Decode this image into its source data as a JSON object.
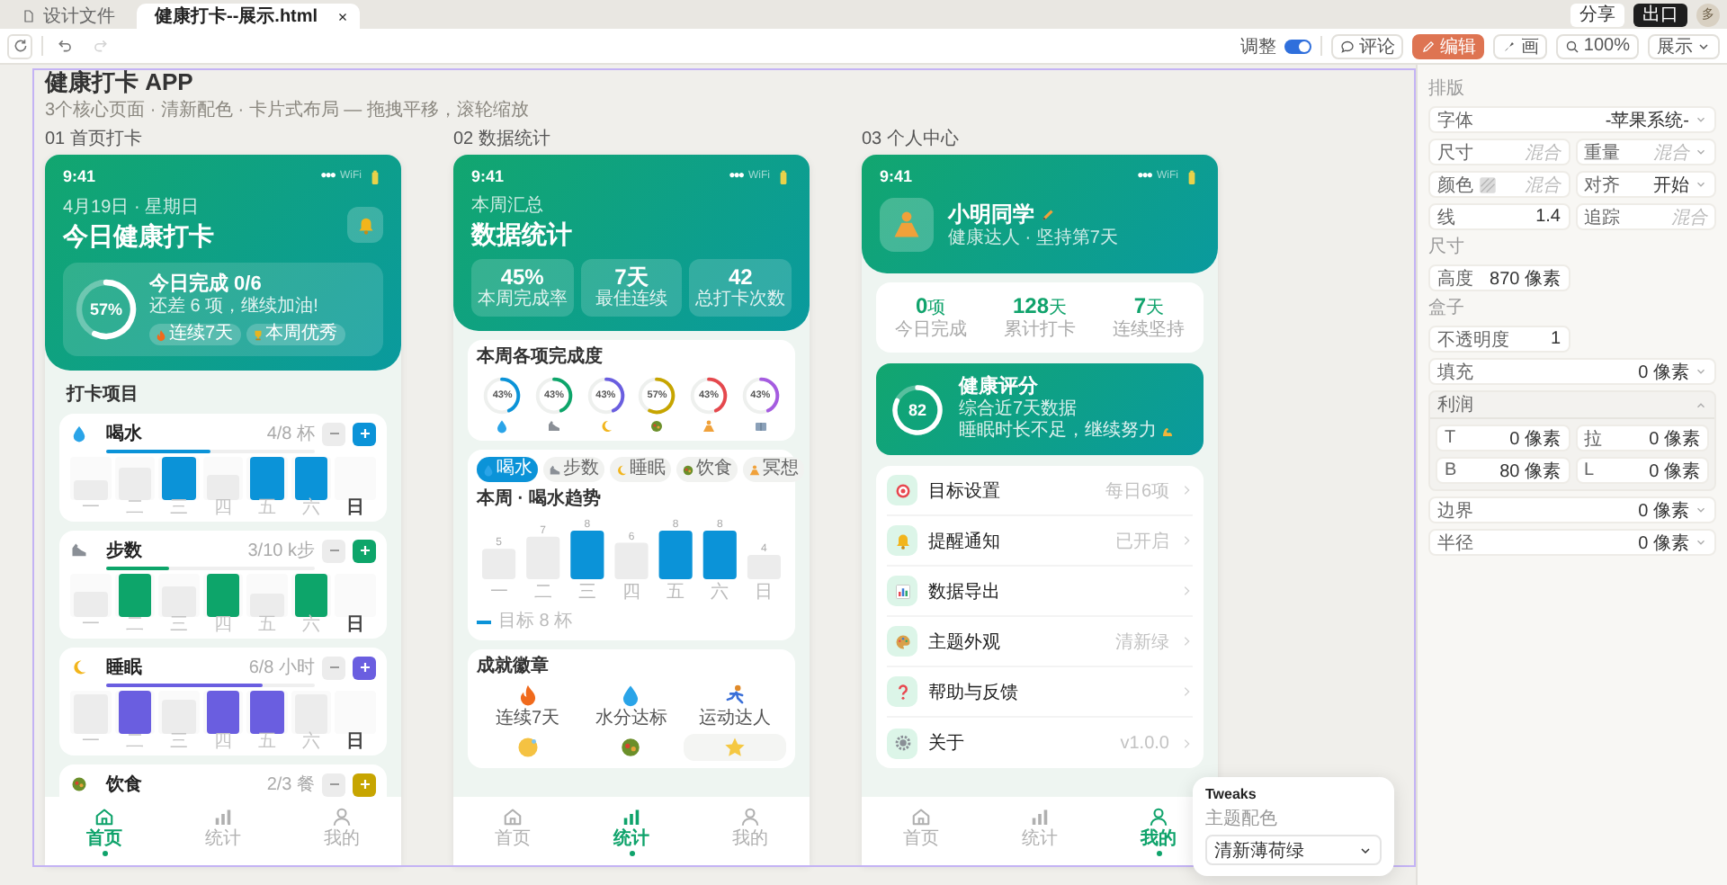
{
  "topbar": {
    "tabs": [
      {
        "label": "设计文件",
        "selected": false
      },
      {
        "label": "健康打卡--展示.html",
        "selected": true
      }
    ],
    "share": "分享",
    "export": "出口",
    "avatar": "多"
  },
  "toolbar": {
    "tweak_label": "调整",
    "tweak_on": true,
    "redo_disabled": true,
    "modes": [
      {
        "label": "评论",
        "selected": false
      },
      {
        "label": "编辑",
        "selected": true
      },
      {
        "label": "画",
        "selected": false
      }
    ],
    "zoom": "100%",
    "present": "展示"
  },
  "canvas": {
    "title": "健康打卡 APP",
    "subtitle": "3个核心页面 · 清新配色 · 卡片式布局 — 拖拽平移，滚轮缩放"
  },
  "screens": [
    {
      "label": "01 首页打卡",
      "kind": "home",
      "status": {
        "time": "9:41",
        "signal": "●●●",
        "network": "WiFi"
      },
      "header": {
        "date": "4月19日 · 星期日",
        "title": "今日健康打卡"
      },
      "summary": {
        "ring_label": "57%",
        "level": 0.57,
        "title": "今日完成 0/6",
        "note": "还差 6 项，继续加油!",
        "chips": [
          "连续7天",
          "本周优秀"
        ]
      },
      "section": "打卡项目",
      "habits": [
        {
          "name": "喝水",
          "amount": "4/8 杯",
          "color": "#0b93d8",
          "level": 0.5,
          "days": [
            {
              "label": "一",
              "level": 0.45,
              "done": false,
              "today": false
            },
            {
              "label": "二",
              "level": 0.75,
              "done": false,
              "today": false
            },
            {
              "label": "三",
              "level": 1,
              "done": true,
              "today": false
            },
            {
              "label": "四",
              "level": 0.6,
              "done": false,
              "today": false
            },
            {
              "label": "五",
              "level": 1,
              "done": true,
              "today": false
            },
            {
              "label": "六",
              "level": 1,
              "done": true,
              "today": false
            },
            {
              "label": "日",
              "today": true
            }
          ]
        },
        {
          "name": "步数",
          "amount": "3/10 k步",
          "color": "#0da56a",
          "level": 0.3,
          "days": [
            {
              "label": "一",
              "level": 0.6,
              "done": false,
              "today": false
            },
            {
              "label": "二",
              "level": 1,
              "done": true,
              "today": false
            },
            {
              "label": "三",
              "level": 0.7,
              "done": false,
              "today": false
            },
            {
              "label": "四",
              "level": 1,
              "done": true,
              "today": false
            },
            {
              "label": "五",
              "level": 0.55,
              "done": false,
              "today": false
            },
            {
              "label": "六",
              "level": 1,
              "done": true,
              "today": false
            },
            {
              "label": "日",
              "today": true
            }
          ]
        },
        {
          "name": "睡眠",
          "amount": "6/8 小时",
          "color": "#6a5ee0",
          "level": 0.75,
          "days": [
            {
              "label": "一",
              "level": 0.9,
              "done": false,
              "today": false
            },
            {
              "label": "二",
              "level": 1,
              "done": true,
              "today": false
            },
            {
              "label": "三",
              "level": 0.8,
              "done": false,
              "today": false
            },
            {
              "label": "四",
              "level": 1,
              "done": true,
              "today": false
            },
            {
              "label": "五",
              "level": 1,
              "done": true,
              "today": false
            },
            {
              "label": "六",
              "level": 0.9,
              "done": false,
              "today": false
            },
            {
              "label": "日",
              "today": true
            }
          ]
        },
        {
          "name": "饮食",
          "amount": "2/3 餐",
          "color": "#c7a500"
        }
      ],
      "nav": [
        {
          "label": "首页",
          "selected": true
        },
        {
          "label": "统计",
          "selected": false
        },
        {
          "label": "我的",
          "selected": false
        }
      ]
    },
    {
      "label": "02 数据统计",
      "kind": "stats",
      "status": {
        "time": "9:41",
        "signal": "●●●",
        "network": "WiFi"
      },
      "header": {
        "date": "本周汇总",
        "title": "数据统计"
      },
      "tiles": [
        {
          "value": "45%",
          "label": "本周完成率"
        },
        {
          "value": "7天",
          "label": "最佳连续"
        },
        {
          "value": "42",
          "label": "总打卡次数"
        }
      ],
      "rings": {
        "title": "本周各项完成度",
        "items": [
          {
            "label": "43%",
            "level": 0.43,
            "color": "#0b93d8"
          },
          {
            "label": "43%",
            "level": 0.43,
            "color": "#0da56a"
          },
          {
            "label": "43%",
            "level": 0.43,
            "color": "#6a5ee0"
          },
          {
            "label": "57%",
            "level": 0.57,
            "color": "#c7a500"
          },
          {
            "label": "43%",
            "level": 0.43,
            "color": "#e5484d"
          },
          {
            "label": "43%",
            "level": 0.43,
            "color": "#a55ce0"
          }
        ]
      },
      "trend": {
        "chips": [
          {
            "label": "喝水",
            "selected": true
          },
          {
            "label": "步数",
            "selected": false
          },
          {
            "label": "睡眠",
            "selected": false
          },
          {
            "label": "饮食",
            "selected": false
          },
          {
            "label": "冥想",
            "selected": false
          }
        ],
        "title": "本周 · 喝水趋势",
        "chart_data": {
          "type": "bar",
          "categories": [
            "一",
            "二",
            "三",
            "四",
            "五",
            "六",
            "日"
          ],
          "series": [
            {
              "color": "#0b93d8",
              "values": [
                null,
                null,
                8,
                null,
                8,
                8,
                null
              ]
            },
            {
              "color": "#ececec",
              "values": [
                5,
                7,
                null,
                6,
                null,
                null,
                4
              ]
            }
          ],
          "data_labels": true
        },
        "legend": "目标 8 杯"
      },
      "badges": {
        "title": "成就徽章",
        "items": [
          {
            "label": "连续7天",
            "highlighted": false
          },
          {
            "label": "水分达标",
            "highlighted": false
          },
          {
            "label": "运动达人",
            "highlighted": false
          },
          {
            "highlighted": false
          },
          {
            "highlighted": false
          },
          {
            "highlighted": true
          }
        ]
      },
      "nav": [
        {
          "label": "首页",
          "selected": false
        },
        {
          "label": "统计",
          "selected": true
        },
        {
          "label": "我的",
          "selected": false
        }
      ]
    },
    {
      "label": "03 个人中心",
      "kind": "profile",
      "status": {
        "time": "9:41",
        "signal": "●●●",
        "network": "WiFi"
      },
      "user": {
        "name": "小明同学",
        "note": "健康达人 · 坚持第7天"
      },
      "stats": [
        {
          "value": "0",
          "unit": "项",
          "label": "今日完成"
        },
        {
          "value": "128",
          "unit": "天",
          "label": "累计打卡"
        },
        {
          "value": "7",
          "unit": "天",
          "label": "连续坚持"
        }
      ],
      "score": {
        "value": "82",
        "level": 0.82,
        "title": "健康评分",
        "note": "综合近7天数据",
        "advice": "睡眠时长不足，继续努力"
      },
      "menu": [
        {
          "label": "目标设置",
          "value": "每日6项"
        },
        {
          "label": "提醒通知",
          "value": "已开启"
        },
        {
          "label": "数据导出"
        },
        {
          "label": "主题外观",
          "value": "清新绿"
        },
        {
          "label": "帮助与反馈"
        },
        {
          "label": "关于",
          "value": "v1.0.0"
        }
      ],
      "nav": [
        {
          "label": "首页",
          "selected": false
        },
        {
          "label": "统计",
          "selected": false
        },
        {
          "label": "我的",
          "selected": true
        }
      ]
    }
  ],
  "tweaks": {
    "title": "Tweaks",
    "label": "主题配色",
    "value": "清新薄荷绿"
  },
  "panel": {
    "sections": [
      {
        "title": "排版",
        "fields": [
          {
            "kind": "field",
            "label": "字体",
            "value": "-苹果系统-",
            "wide": true,
            "dropdown": true,
            "mixed": false,
            "swatch": false
          },
          {
            "kind": "field",
            "label": "尺寸",
            "value": "混合",
            "wide": false,
            "dropdown": false,
            "mixed": true,
            "swatch": false
          },
          {
            "kind": "field",
            "label": "重量",
            "value": "混合",
            "wide": false,
            "dropdown": true,
            "mixed": true,
            "swatch": false
          },
          {
            "kind": "field",
            "label": "颜色",
            "value": "混合",
            "wide": false,
            "dropdown": false,
            "mixed": true,
            "swatch": true
          },
          {
            "kind": "field",
            "label": "对齐",
            "value": "开始",
            "wide": false,
            "dropdown": true,
            "mixed": false,
            "swatch": false
          },
          {
            "kind": "field",
            "label": "线",
            "value": "1.4",
            "wide": false,
            "dropdown": false,
            "mixed": false,
            "swatch": false
          },
          {
            "kind": "field",
            "label": "追踪",
            "value": "混合",
            "wide": false,
            "dropdown": false,
            "mixed": true,
            "swatch": false
          }
        ]
      },
      {
        "title": "尺寸",
        "fields": [
          {
            "kind": "field",
            "label": "高度",
            "value": "870 像素",
            "wide": false,
            "dropdown": false,
            "mixed": false,
            "swatch": false
          }
        ]
      },
      {
        "title": "盒子",
        "fields": [
          {
            "kind": "field",
            "label": "不透明度",
            "value": "1",
            "wide": false,
            "dropdown": false,
            "mixed": false,
            "swatch": false
          },
          {
            "kind": "field",
            "label": "填充",
            "value": "0 像素",
            "wide": true,
            "dropdown": true,
            "mixed": false,
            "swatch": false
          },
          {
            "kind": "group",
            "label": "利润",
            "expanded": true,
            "fields": [
              {
                "kind": "field",
                "label": "T",
                "value": "0 像素",
                "wide": false,
                "dropdown": false,
                "mixed": false,
                "swatch": false
              },
              {
                "kind": "field",
                "label": "拉",
                "value": "0 像素",
                "wide": false,
                "dropdown": false,
                "mixed": false,
                "swatch": false
              },
              {
                "kind": "field",
                "label": "B",
                "value": "80 像素",
                "wide": false,
                "dropdown": false,
                "mixed": false,
                "swatch": false
              },
              {
                "kind": "field",
                "label": "L",
                "value": "0 像素",
                "wide": false,
                "dropdown": false,
                "mixed": false,
                "swatch": false
              }
            ]
          },
          {
            "kind": "field",
            "label": "边界",
            "value": "0 像素",
            "wide": true,
            "dropdown": true,
            "mixed": false,
            "swatch": false
          },
          {
            "kind": "field",
            "label": "半径",
            "value": "0 像素",
            "wide": true,
            "dropdown": true,
            "mixed": false,
            "swatch": false
          }
        ]
      }
    ]
  }
}
